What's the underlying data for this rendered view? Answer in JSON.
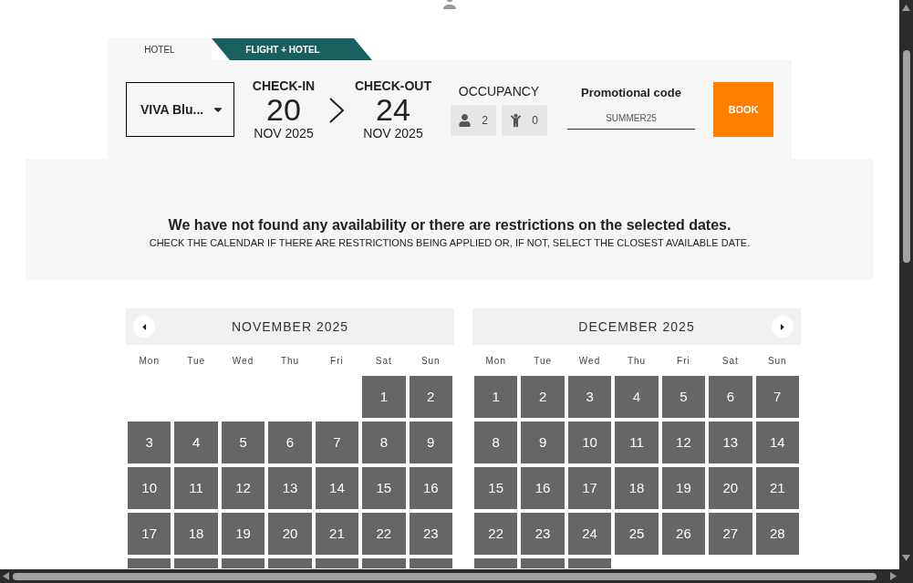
{
  "tabs": [
    {
      "label": "HOTEL",
      "selected": true
    },
    {
      "label": "FLIGHT + HOTEL",
      "selected": false
    }
  ],
  "search": {
    "hotel": {
      "value": "VIVA Blu..."
    },
    "check_in": {
      "label": "CHECK-IN",
      "day": "20",
      "month": "NOV 2025"
    },
    "check_out": {
      "label": "CHECK-OUT",
      "day": "24",
      "month": "NOV 2025"
    },
    "occupancy": {
      "label": "OCCUPANCY",
      "guests": [
        {
          "kind": "adult",
          "count": "2"
        },
        {
          "kind": "child",
          "count": "0"
        }
      ]
    },
    "promo": {
      "label": "Promotional code",
      "value": "SUMMER25"
    },
    "book_button": "BOOK"
  },
  "notice": {
    "title": "We have not found any availability or there are restrictions on the selected dates.",
    "message": "CHECK THE CALENDAR IF THERE ARE RESTRICTIONS BEING APPLIED OR, IF NOT, SELECT THE CLOSEST AVAILABLE DATE."
  },
  "calendars": [
    {
      "title": "NOVEMBER 2025",
      "prev_arrow": true,
      "next_arrow": false,
      "weekdays": [
        "Mon",
        "Tue",
        "Wed",
        "Thu",
        "Fri",
        "Sat",
        "Sun"
      ],
      "cells": [
        {
          "kind": "empty"
        },
        {
          "kind": "empty"
        },
        {
          "kind": "empty"
        },
        {
          "kind": "empty"
        },
        {
          "kind": "empty"
        },
        {
          "kind": "day",
          "label": "1"
        },
        {
          "kind": "day",
          "label": "2"
        },
        {
          "kind": "day",
          "label": "3"
        },
        {
          "kind": "day",
          "label": "4"
        },
        {
          "kind": "day",
          "label": "5"
        },
        {
          "kind": "day",
          "label": "6"
        },
        {
          "kind": "day",
          "label": "7"
        },
        {
          "kind": "day",
          "label": "8"
        },
        {
          "kind": "day",
          "label": "9"
        },
        {
          "kind": "day",
          "label": "10"
        },
        {
          "kind": "day",
          "label": "11"
        },
        {
          "kind": "day",
          "label": "12"
        },
        {
          "kind": "day",
          "label": "13"
        },
        {
          "kind": "day",
          "label": "14"
        },
        {
          "kind": "day",
          "label": "15"
        },
        {
          "kind": "day",
          "label": "16"
        },
        {
          "kind": "day",
          "label": "17"
        },
        {
          "kind": "day",
          "label": "18"
        },
        {
          "kind": "day",
          "label": "19"
        },
        {
          "kind": "day",
          "label": "20"
        },
        {
          "kind": "day",
          "label": "21"
        },
        {
          "kind": "day",
          "label": "22"
        },
        {
          "kind": "day",
          "label": "23"
        },
        {
          "kind": "cut"
        },
        {
          "kind": "cut"
        },
        {
          "kind": "cut"
        },
        {
          "kind": "cut"
        },
        {
          "kind": "cut"
        },
        {
          "kind": "cut"
        },
        {
          "kind": "cut"
        }
      ]
    },
    {
      "title": "DECEMBER 2025",
      "prev_arrow": false,
      "next_arrow": true,
      "weekdays": [
        "Mon",
        "Tue",
        "Wed",
        "Thu",
        "Fri",
        "Sat",
        "Sun"
      ],
      "cells": [
        {
          "kind": "day",
          "label": "1"
        },
        {
          "kind": "day",
          "label": "2"
        },
        {
          "kind": "day",
          "label": "3"
        },
        {
          "kind": "day",
          "label": "4"
        },
        {
          "kind": "day",
          "label": "5"
        },
        {
          "kind": "day",
          "label": "6"
        },
        {
          "kind": "day",
          "label": "7"
        },
        {
          "kind": "day",
          "label": "8"
        },
        {
          "kind": "day",
          "label": "9"
        },
        {
          "kind": "day",
          "label": "10"
        },
        {
          "kind": "day",
          "label": "11"
        },
        {
          "kind": "day",
          "label": "12"
        },
        {
          "kind": "day",
          "label": "13"
        },
        {
          "kind": "day",
          "label": "14"
        },
        {
          "kind": "day",
          "label": "15"
        },
        {
          "kind": "day",
          "label": "16"
        },
        {
          "kind": "day",
          "label": "17"
        },
        {
          "kind": "day",
          "label": "18"
        },
        {
          "kind": "day",
          "label": "19"
        },
        {
          "kind": "day",
          "label": "20"
        },
        {
          "kind": "day",
          "label": "21"
        },
        {
          "kind": "day",
          "label": "22"
        },
        {
          "kind": "day",
          "label": "23"
        },
        {
          "kind": "day",
          "label": "24"
        },
        {
          "kind": "day",
          "label": "25"
        },
        {
          "kind": "day",
          "label": "26"
        },
        {
          "kind": "day",
          "label": "27"
        },
        {
          "kind": "day",
          "label": "28"
        },
        {
          "kind": "cut"
        },
        {
          "kind": "cut"
        },
        {
          "kind": "cut"
        }
      ]
    }
  ]
}
